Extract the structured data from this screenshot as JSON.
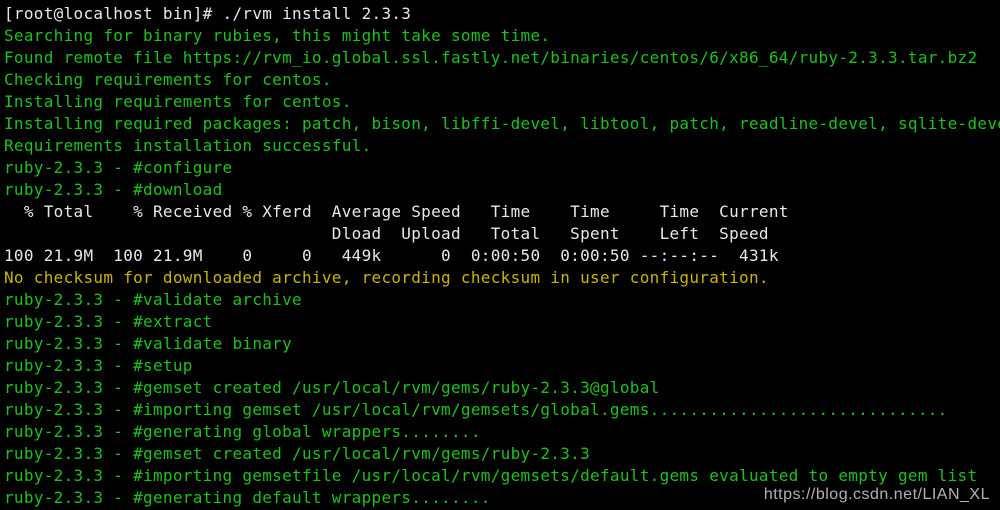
{
  "colors": {
    "background": "#000000",
    "default_text": "#e8e8e8",
    "success_text": "#1cc21c",
    "warning_text": "#c8b400"
  },
  "terminal": {
    "lines": [
      {
        "text": "[root@localhost bin]# ./rvm install 2.3.3",
        "color": "white"
      },
      {
        "text": "Searching for binary rubies, this might take some time.",
        "color": "green"
      },
      {
        "text": "Found remote file https://rvm_io.global.ssl.fastly.net/binaries/centos/6/x86_64/ruby-2.3.3.tar.bz2",
        "color": "green"
      },
      {
        "text": "Checking requirements for centos.",
        "color": "green"
      },
      {
        "text": "Installing requirements for centos.",
        "color": "green"
      },
      {
        "text": "Installing required packages: patch, bison, libffi-devel, libtool, patch, readline-devel, sqlite-devel",
        "color": "green"
      },
      {
        "text": "Requirements installation successful.",
        "color": "green"
      },
      {
        "text": "ruby-2.3.3 - #configure",
        "color": "green"
      },
      {
        "text": "ruby-2.3.3 - #download",
        "color": "green"
      },
      {
        "text": "  % Total    % Received % Xferd  Average Speed   Time    Time     Time  Current",
        "color": "white"
      },
      {
        "text": "                                 Dload  Upload   Total   Spent    Left  Speed",
        "color": "white"
      },
      {
        "text": "100 21.9M  100 21.9M    0     0   449k      0  0:00:50  0:00:50 --:--:--  431k",
        "color": "white"
      },
      {
        "text": "No checksum for downloaded archive, recording checksum in user configuration.",
        "color": "yellow"
      },
      {
        "text": "ruby-2.3.3 - #validate archive",
        "color": "green"
      },
      {
        "text": "ruby-2.3.3 - #extract",
        "color": "green"
      },
      {
        "text": "ruby-2.3.3 - #validate binary",
        "color": "green"
      },
      {
        "text": "ruby-2.3.3 - #setup",
        "color": "green"
      },
      {
        "text": "ruby-2.3.3 - #gemset created /usr/local/rvm/gems/ruby-2.3.3@global",
        "color": "green"
      },
      {
        "text": "ruby-2.3.3 - #importing gemset /usr/local/rvm/gemsets/global.gems..............................",
        "color": "green"
      },
      {
        "text": "ruby-2.3.3 - #generating global wrappers........",
        "color": "green"
      },
      {
        "text": "ruby-2.3.3 - #gemset created /usr/local/rvm/gems/ruby-2.3.3",
        "color": "green"
      },
      {
        "text": "ruby-2.3.3 - #importing gemsetfile /usr/local/rvm/gemsets/default.gems evaluated to empty gem list",
        "color": "green"
      },
      {
        "text": "ruby-2.3.3 - #generating default wrappers........",
        "color": "green"
      }
    ]
  },
  "watermark": {
    "text": "https://blog.csdn.net/LIAN_XL"
  }
}
